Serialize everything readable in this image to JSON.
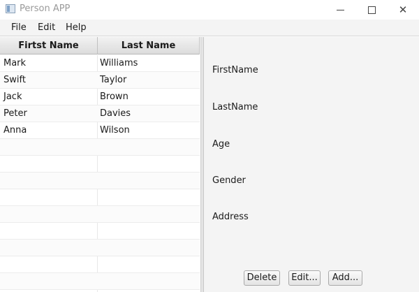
{
  "window": {
    "title": "Person APP",
    "minimize_glyph": "",
    "maximize_glyph": "",
    "close_glyph": "✕"
  },
  "menu": [
    "File",
    "Edit",
    "Help"
  ],
  "table": {
    "columns": [
      "Firtst Name",
      "Last Name"
    ],
    "rows": [
      {
        "first": "Mark",
        "last": "Williams"
      },
      {
        "first": "Swift",
        "last": "Taylor"
      },
      {
        "first": "Jack",
        "last": "Brown"
      },
      {
        "first": "Peter",
        "last": "Davies"
      },
      {
        "first": "Anna",
        "last": "Wilson"
      }
    ],
    "total_visible_rows": 14
  },
  "detail": {
    "labels": [
      "FirstName",
      "LastName",
      "Age",
      "Gender",
      "Address"
    ]
  },
  "buttons": {
    "delete": "Delete",
    "edit": "Edit...",
    "add": "Add..."
  }
}
